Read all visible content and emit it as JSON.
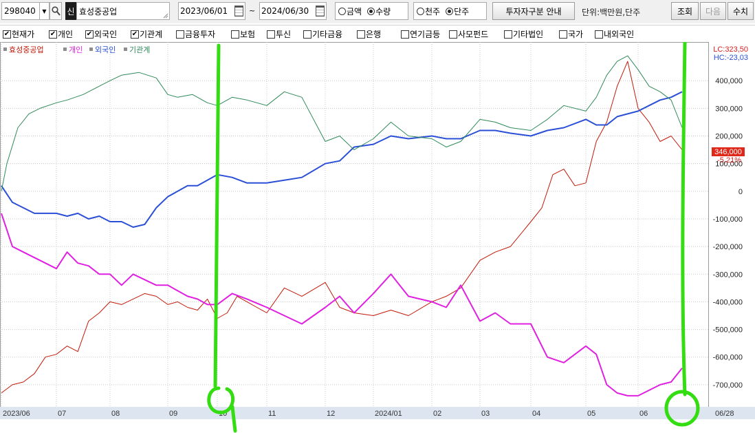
{
  "toolbar": {
    "stock_code": "298040",
    "sin_badge": "신",
    "stock_name": "효성중공업",
    "start_date": "2023/06/01",
    "tilde": "~",
    "end_date": "2024/06/30",
    "mode_options": [
      "금액",
      "수량"
    ],
    "mode_selected": 1,
    "unit_options": [
      "천주",
      "단주"
    ],
    "unit_selected": 1,
    "investor_guide_label": "투자자구분 안내",
    "unit_text": "단위:백만원,단주",
    "query_label": "조회",
    "next_label": "다음",
    "numeric_label": "수치"
  },
  "filters": [
    {
      "label": "현재가",
      "checked": true
    },
    {
      "label": "개인",
      "checked": true
    },
    {
      "label": "외국인",
      "checked": true
    },
    {
      "label": "기관계",
      "checked": true
    },
    {
      "label": "금융투자",
      "checked": false
    },
    {
      "label": "보험",
      "checked": false
    },
    {
      "label": "투신",
      "checked": false
    },
    {
      "label": "기타금융",
      "checked": false
    },
    {
      "label": "은행",
      "checked": false
    },
    {
      "label": "연기금등",
      "checked": false
    },
    {
      "label": "사모펀드",
      "checked": false
    },
    {
      "label": "기타법인",
      "checked": false
    },
    {
      "label": "국가",
      "checked": false
    },
    {
      "label": "내외국인",
      "checked": false
    }
  ],
  "chart_data": {
    "type": "line",
    "legend": [
      "효성중공업",
      "개인",
      "외국인",
      "기관계"
    ],
    "legend_position": "top-left",
    "grid": true,
    "colors": {
      "price": "#c21807",
      "individual": "#e020e0",
      "foreign": "#2a4fd6",
      "institution": "#2f8a5a",
      "price_tag_bg": "#e0281a",
      "annotation": "#33dd11"
    },
    "lc_text": "LC:323,50",
    "hc_text": "HC:-23,03",
    "last_price_tag": "346,000",
    "change_text": "-5,21%",
    "date_labels": [
      "2023/06",
      "07",
      "08",
      "09",
      "10",
      "11",
      "12",
      "2024/01",
      "02",
      "03",
      "04",
      "05",
      "06",
      "06/28"
    ],
    "x_month_index": [
      0,
      1,
      2,
      3,
      4,
      5,
      6,
      7,
      8,
      9,
      10,
      11,
      12
    ],
    "y_ticks": [
      400000,
      300000,
      200000,
      100000,
      0,
      -100000,
      -200000,
      -300000,
      -400000,
      -500000,
      -600000,
      -700000
    ],
    "y_tick_labels": [
      "400,000",
      "300,000",
      "200,000",
      "100,000",
      "0",
      "-100,000",
      "-200,000",
      "-300,000",
      "-400,000",
      "-500,000",
      "-600,000",
      "-700,000"
    ],
    "ylim": [
      -780000,
      540000
    ],
    "x_range": [
      0,
      13
    ],
    "series": [
      {
        "name": "효성중공업",
        "key": "price",
        "width": 1,
        "x": [
          0,
          0.2,
          0.4,
          0.6,
          0.8,
          1.0,
          1.2,
          1.4,
          1.6,
          1.8,
          2.0,
          2.2,
          2.4,
          2.6,
          2.8,
          3.0,
          3.2,
          3.4,
          3.6,
          3.8,
          4.0,
          4.2,
          4.4,
          4.6,
          4.8,
          5.0,
          5.3,
          5.6,
          6.0,
          6.3,
          6.6,
          7.0,
          7.3,
          7.6,
          8.0,
          8.3,
          8.6,
          9.0,
          9.3,
          9.6,
          10.0,
          10.2,
          10.4,
          10.6,
          10.8,
          11.0,
          11.2,
          11.4,
          11.6,
          11.8,
          12.0,
          12.2,
          12.4,
          12.6,
          12.8
        ],
        "values": [
          -730000,
          -700000,
          -690000,
          -660000,
          -600000,
          -590000,
          -560000,
          -580000,
          -470000,
          -440000,
          -400000,
          -410000,
          -390000,
          -370000,
          -380000,
          -410000,
          -400000,
          -420000,
          -430000,
          -390000,
          -460000,
          -440000,
          -380000,
          -400000,
          -420000,
          -440000,
          -350000,
          -380000,
          -330000,
          -420000,
          -440000,
          -450000,
          -430000,
          -450000,
          -400000,
          -380000,
          -350000,
          -250000,
          -220000,
          -200000,
          -110000,
          -60000,
          60000,
          80000,
          20000,
          30000,
          180000,
          250000,
          380000,
          470000,
          300000,
          250000,
          180000,
          200000,
          150000
        ]
      },
      {
        "name": "개인",
        "key": "individual",
        "width": 2,
        "x": [
          0,
          0.2,
          0.4,
          0.6,
          0.8,
          1.0,
          1.2,
          1.4,
          1.6,
          1.8,
          2.0,
          2.2,
          2.4,
          2.6,
          2.8,
          3.0,
          3.2,
          3.4,
          3.6,
          3.8,
          4.0,
          4.3,
          4.6,
          5.0,
          5.3,
          5.6,
          6.0,
          6.3,
          6.6,
          7.0,
          7.3,
          7.6,
          8.0,
          8.3,
          8.6,
          9.0,
          9.3,
          9.6,
          10.0,
          10.3,
          10.6,
          11.0,
          11.2,
          11.4,
          11.6,
          11.8,
          12.0,
          12.2,
          12.4,
          12.6,
          12.8
        ],
        "values": [
          -80000,
          -200000,
          -220000,
          -240000,
          -260000,
          -280000,
          -220000,
          -260000,
          -270000,
          -300000,
          -300000,
          -340000,
          -300000,
          -320000,
          -340000,
          -340000,
          -360000,
          -380000,
          -390000,
          -410000,
          -410000,
          -370000,
          -390000,
          -420000,
          -450000,
          -480000,
          -420000,
          -380000,
          -440000,
          -370000,
          -300000,
          -380000,
          -400000,
          -420000,
          -340000,
          -470000,
          -440000,
          -480000,
          -480000,
          -600000,
          -620000,
          -560000,
          -590000,
          -700000,
          -730000,
          -740000,
          -740000,
          -720000,
          -700000,
          -690000,
          -640000
        ]
      },
      {
        "name": "외국인",
        "key": "foreign",
        "width": 2,
        "x": [
          0,
          0.2,
          0.4,
          0.6,
          0.8,
          1.0,
          1.2,
          1.4,
          1.6,
          1.8,
          2.0,
          2.2,
          2.4,
          2.6,
          2.8,
          3.0,
          3.2,
          3.4,
          3.6,
          3.8,
          4.0,
          4.3,
          4.6,
          5.0,
          5.3,
          5.6,
          6.0,
          6.3,
          6.6,
          7.0,
          7.3,
          7.6,
          8.0,
          8.3,
          8.6,
          9.0,
          9.3,
          9.6,
          10.0,
          10.3,
          10.6,
          11.0,
          11.2,
          11.4,
          11.6,
          11.8,
          12.0,
          12.2,
          12.4,
          12.6,
          12.8
        ],
        "values": [
          20000,
          -40000,
          -60000,
          -80000,
          -80000,
          -80000,
          -90000,
          -80000,
          -100000,
          -90000,
          -110000,
          -110000,
          -130000,
          -120000,
          -60000,
          -20000,
          0,
          20000,
          20000,
          40000,
          60000,
          50000,
          30000,
          30000,
          40000,
          50000,
          100000,
          110000,
          160000,
          170000,
          200000,
          190000,
          200000,
          190000,
          190000,
          220000,
          220000,
          210000,
          200000,
          220000,
          230000,
          260000,
          240000,
          240000,
          270000,
          280000,
          290000,
          310000,
          330000,
          340000,
          360000
        ]
      },
      {
        "name": "기관계",
        "key": "institution",
        "width": 1,
        "x": [
          0,
          0.1,
          0.3,
          0.5,
          0.7,
          1.0,
          1.2,
          1.5,
          1.8,
          2.0,
          2.2,
          2.5,
          2.8,
          3.0,
          3.2,
          3.5,
          3.8,
          4.0,
          4.3,
          4.6,
          5.0,
          5.3,
          5.6,
          6.0,
          6.3,
          6.6,
          7.0,
          7.3,
          7.6,
          8.0,
          8.3,
          8.6,
          9.0,
          9.3,
          9.6,
          10.0,
          10.3,
          10.6,
          11.0,
          11.2,
          11.4,
          11.6,
          11.8,
          12.0,
          12.2,
          12.4,
          12.6,
          12.8
        ],
        "values": [
          0,
          100000,
          230000,
          280000,
          300000,
          320000,
          330000,
          350000,
          380000,
          400000,
          420000,
          430000,
          410000,
          350000,
          340000,
          350000,
          320000,
          310000,
          340000,
          330000,
          310000,
          360000,
          340000,
          180000,
          200000,
          150000,
          190000,
          250000,
          200000,
          190000,
          160000,
          180000,
          260000,
          250000,
          230000,
          220000,
          260000,
          310000,
          290000,
          340000,
          420000,
          470000,
          490000,
          440000,
          380000,
          360000,
          330000,
          230000
        ]
      }
    ]
  }
}
